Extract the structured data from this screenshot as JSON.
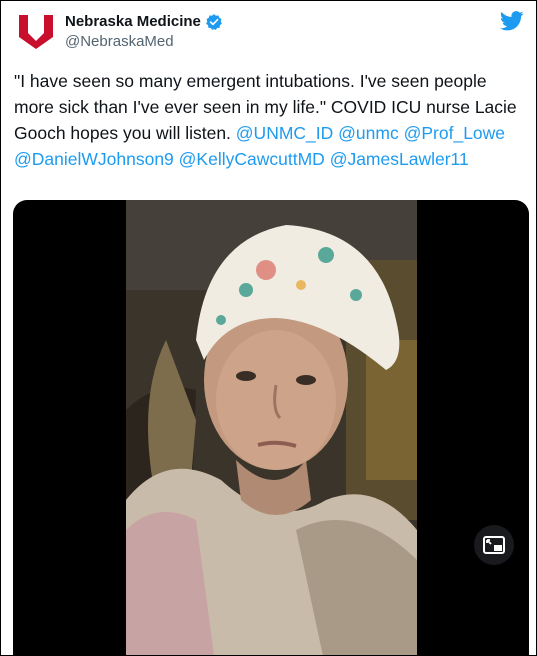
{
  "account": {
    "display_name": "Nebraska Medicine",
    "handle": "@NebraskaMed",
    "verified": true
  },
  "tweet": {
    "segments": [
      {
        "text": "\"I have seen so many emergent intubations. I've seen people more sick than I've ever seen in my life.\" COVID ICU nurse Lacie Gooch hopes you will listen. ",
        "kind": "text"
      },
      {
        "text": "@UNMC_ID",
        "kind": "mention"
      },
      {
        "text": " ",
        "kind": "text"
      },
      {
        "text": "@unmc",
        "kind": "mention"
      },
      {
        "text": " ",
        "kind": "text"
      },
      {
        "text": "@Prof_Lowe",
        "kind": "mention"
      },
      {
        "text": " ",
        "kind": "text"
      },
      {
        "text": "@DanielWJohnson9",
        "kind": "mention"
      },
      {
        "text": " ",
        "kind": "text"
      },
      {
        "text": "@KellyCawcuttMD",
        "kind": "mention"
      },
      {
        "text": " ",
        "kind": "text"
      },
      {
        "text": "@JamesLawler11",
        "kind": "mention"
      }
    ]
  },
  "media": {
    "type": "video",
    "pip_icon": "picture-in-picture-icon"
  },
  "icons": {
    "logo": "nebraska-medicine-logo",
    "verified": "verified-badge-icon",
    "platform": "twitter-bird-icon"
  },
  "colors": {
    "mention": "#1d9bf0",
    "verified": "#1d9bf0",
    "brand_red": "#c8102e",
    "twitter_blue": "#1d9bf0"
  }
}
